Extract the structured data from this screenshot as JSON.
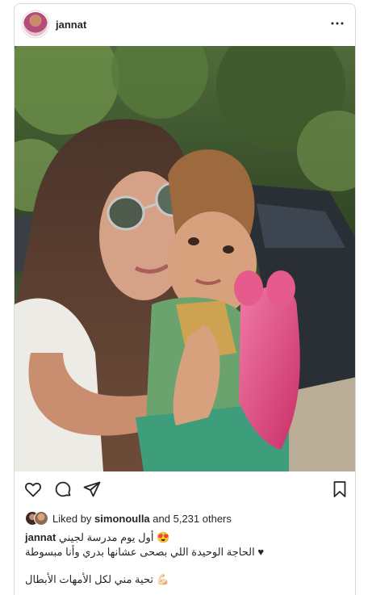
{
  "post": {
    "username": "jannat",
    "liked_by_prefix": "Liked by",
    "liked_by_user": "simonoulla",
    "liked_by_rest": "and 5,231 others",
    "caption_line1": "أول يوم مدرسة لجيني 😍",
    "caption_line2": "الحاجة الوحيدة اللي بصحى عشانها بدري وأنا مبسوطة ♥",
    "caption_line3": "تحية مني لكل الأمهات الأبطال 💪🏻"
  },
  "icons": {
    "more": "more-horizontal-icon",
    "like": "heart-icon",
    "comment": "comment-icon",
    "share": "send-icon",
    "save": "bookmark-icon"
  },
  "colors": {
    "border": "#dbdbdb",
    "text": "#262626",
    "backpack": "#e2457e"
  }
}
